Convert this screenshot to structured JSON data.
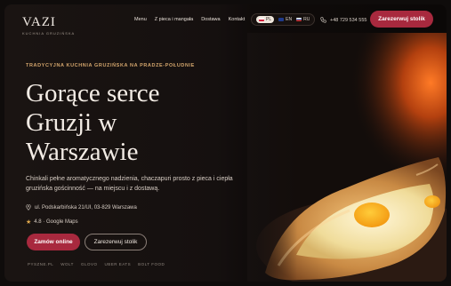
{
  "brand": {
    "name": "VAZI",
    "tagline": "KUCHNIA GRUZIŃSKA"
  },
  "nav": {
    "items": [
      "Menu",
      "Z pieca i mangała",
      "Dostawa",
      "Kontakt"
    ]
  },
  "languages": [
    {
      "code": "PL",
      "active": true
    },
    {
      "code": "EN",
      "active": false
    },
    {
      "code": "RU",
      "active": false
    }
  ],
  "phone": "+48 729 534 555",
  "header_cta": "Zarezerwuj stolik",
  "hero": {
    "eyebrow": "TRADYCYJNA KUCHNIA GRUZIŃSKA NA PRADZE-POŁUDNIE",
    "title_lines": [
      "Gorące serce",
      "Gruzji w",
      "Warszawie"
    ],
    "description": "Chinkali pełne aromatycznego nadzienia, chaczapuri prosto z pieca i ciepła gruzińska gościnność — na miejscu i z dostawą.",
    "address": "ul. Podskarbińska 21/UI, 03-829 Warszawa",
    "rating": "4.8 · Google Maps",
    "primary_cta": "Zamów online",
    "secondary_cta": "Zarezerwuj stolik"
  },
  "partners": [
    "PYSZNE.PL",
    "WOLT",
    "GLOVO",
    "UBER EATS",
    "BOLT FOOD"
  ],
  "colors": {
    "accent": "#a8293e",
    "gold": "#d3a56c",
    "background": "#15100f"
  }
}
